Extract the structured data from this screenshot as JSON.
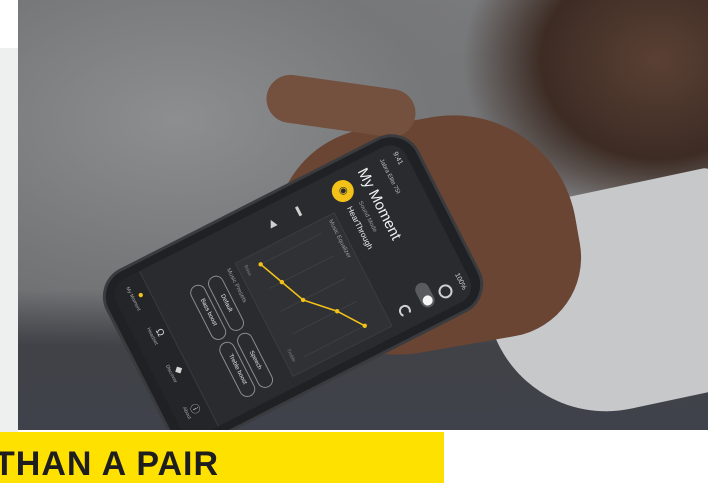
{
  "banner": {
    "text": "THAN A PAIR"
  },
  "app": {
    "status_time": "9:41",
    "battery": "100%",
    "device_name": "Jabra Elite 75t",
    "page_title": "My Moment",
    "sound_mode_label": "Sound Mode",
    "sound_mode_value": "HearThrough",
    "equalizer_title": "Music Equalizer",
    "eq_ticks": [
      "Bass",
      "Treble"
    ],
    "eq_values": [
      0.05,
      0.2,
      0.35,
      0.7,
      0.95
    ],
    "presets_label": "Music Presets",
    "presets": [
      "Default",
      "Speech",
      "Bass boost",
      "Treble boost"
    ],
    "nav": [
      {
        "label": "My Moment",
        "icon": "moment-icon"
      },
      {
        "label": "Headset",
        "icon": "headset-icon"
      },
      {
        "label": "Discover",
        "icon": "discover-icon"
      },
      {
        "label": "About",
        "icon": "about-icon"
      }
    ]
  },
  "colors": {
    "accent": "#ffe100",
    "app_accent": "#f2c218",
    "screen": "#2a2b2e"
  }
}
